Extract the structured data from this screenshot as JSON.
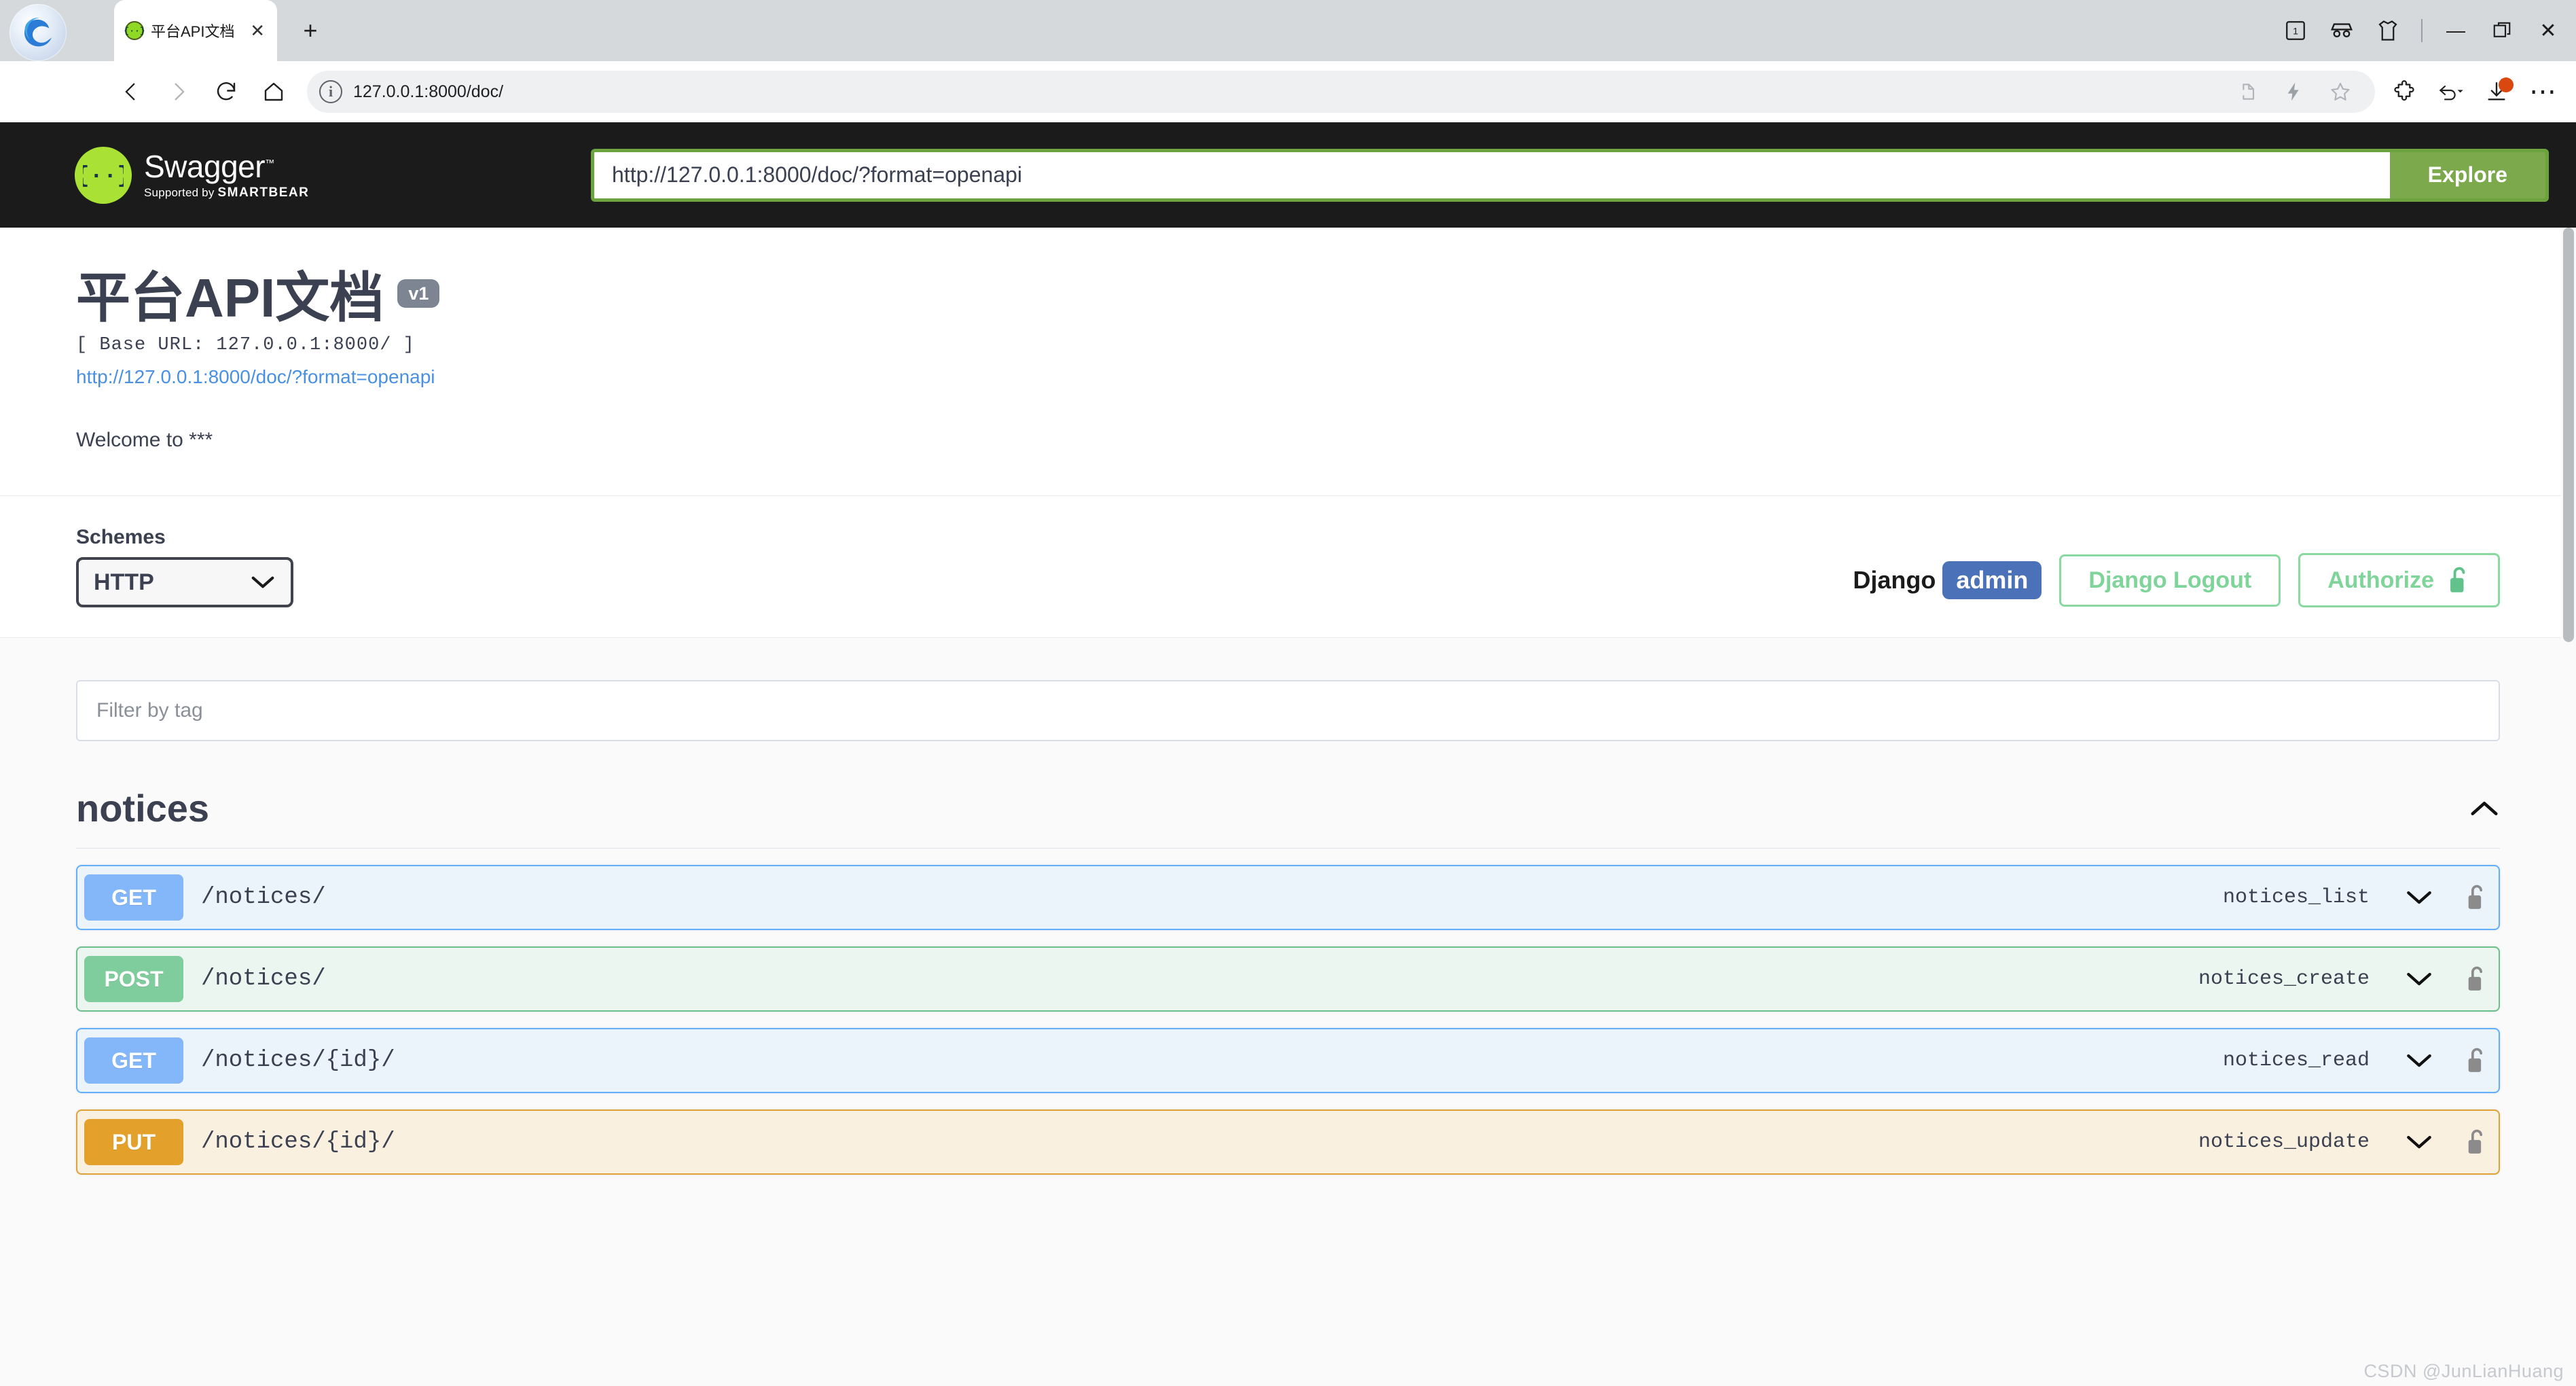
{
  "browser": {
    "tab": {
      "title": "平台API文档",
      "favicon": "swagger-braces-icon",
      "close_label": "✕"
    },
    "new_tab_label": "+",
    "nav": {
      "back": "‹",
      "forward": "›",
      "reload": "⟳",
      "home": "⌂"
    },
    "address": {
      "value": "127.0.0.1:8000/doc/",
      "info_icon": "ⓘ"
    },
    "window_controls": {
      "minimize": "—",
      "maximize": "❐",
      "close": "✕"
    },
    "tab_count_badge": "1",
    "icons": {
      "tab_list": "tab-count-icon",
      "incognito": "incognito-glasses-icon",
      "collections": "shirt-icon",
      "share": "share-icon",
      "performance": "lightning-icon",
      "favorite": "star-icon",
      "extensions": "puzzle-icon",
      "history_back": "undo-arrow-icon",
      "downloads": "download-arrow-icon",
      "settings_more": "ellipsis-icon"
    }
  },
  "swagger_topbar": {
    "logo_text": "Swagger",
    "trademark": "™",
    "supported_by_prefix": "Supported by ",
    "supported_by_brand": "SMARTBEAR",
    "spec_url": "http://127.0.0.1:8000/doc/?format=openapi",
    "explore_label": "Explore"
  },
  "info": {
    "title": "平台API文档",
    "version_badge": "v1",
    "base_url": "[ Base URL: 127.0.0.1:8000/ ]",
    "spec_link": "http://127.0.0.1:8000/doc/?format=openapi",
    "description": "Welcome to ***"
  },
  "schemes": {
    "label": "Schemes",
    "selected": "HTTP",
    "options": [
      "HTTP"
    ]
  },
  "auth": {
    "django_label": "Django",
    "username": "admin",
    "logout_label": "Django Logout",
    "authorize_label": "Authorize",
    "authorize_icon": "unlocked-padlock-icon"
  },
  "filter": {
    "placeholder": "Filter by tag",
    "value": ""
  },
  "tags": [
    {
      "name": "notices",
      "collapse_icon": "chevron-up-icon",
      "operations": [
        {
          "verb": "GET",
          "path": "/notices/",
          "operation_id": "notices_list",
          "lock_icon": "unlocked-padlock-icon",
          "expand_icon": "chevron-down-icon"
        },
        {
          "verb": "POST",
          "path": "/notices/",
          "operation_id": "notices_create",
          "lock_icon": "unlocked-padlock-icon",
          "expand_icon": "chevron-down-icon"
        },
        {
          "verb": "GET",
          "path": "/notices/{id}/",
          "operation_id": "notices_read",
          "lock_icon": "unlocked-padlock-icon",
          "expand_icon": "chevron-down-icon"
        },
        {
          "verb": "PUT",
          "path": "/notices/{id}/",
          "operation_id": "notices_update",
          "lock_icon": "unlocked-padlock-icon",
          "expand_icon": "chevron-down-icon"
        }
      ]
    }
  ],
  "watermark": "CSDN @JunLianHuang",
  "colors": {
    "swagger_green": "#7ba94b",
    "topbar_bg": "#1b1b1b",
    "logo_green": "#a9e234",
    "get_blue": "#61affe",
    "post_green": "#6cc08b",
    "put_orange": "#e0a33a",
    "text_dark": "#3b4151",
    "link_blue": "#4990e2",
    "django_admin_blue": "#4b72b8",
    "authorize_green": "#89d9a0"
  }
}
